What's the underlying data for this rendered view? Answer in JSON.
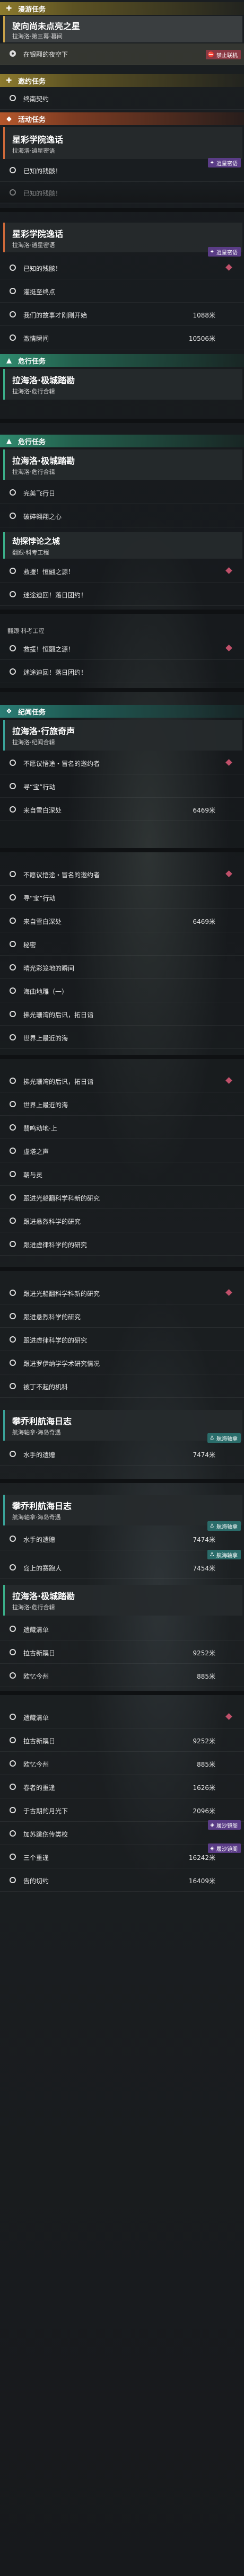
{
  "s1": {
    "header": "漫游任务",
    "title": "驶向尚未点亮之星",
    "sub": "拉海洛·第三幕·暮间",
    "row": "在银翮的夜空下",
    "tag": "禁止联机"
  },
  "s2": {
    "header": "邀约任务",
    "row": "终南契约"
  },
  "s3": {
    "header": "活动任务",
    "title": "星彩学院逸话",
    "sub": "拉海洛·逍星密语",
    "rows": [
      {
        "t": "已知的残骸！"
      },
      {
        "t": "已知的残骸！"
      }
    ],
    "tag": "逍星密语"
  },
  "s4": {
    "title": "星彩学院逸话",
    "sub": "拉海洛·逍星密语",
    "tag": "逍星密语",
    "rows": [
      {
        "t": "已知的残骸！"
      },
      {
        "t": "灌挺至终点"
      },
      {
        "t": "我们的故事才刚刚开始",
        "n": "1088米"
      },
      {
        "t": "激情瞬间",
        "n": "10506米"
      }
    ]
  },
  "s5": {
    "header": "危行任务",
    "title": "拉海洛·极城踏勘",
    "sub": "拉海洛·危行合辑"
  },
  "s6": {
    "header": "危行任务",
    "title": "拉海洛·极城踏勘",
    "sub": "拉海洛·危行合辑",
    "rows": [
      {
        "t": "完美飞行日"
      },
      {
        "t": "破碎翱翔之心"
      }
    ],
    "title2": "劫探悖论之城",
    "sub2": "翻跟·科考工程",
    "rows2": [
      {
        "t": "救援！恒翮之源！"
      },
      {
        "t": "迷途迫回！落日团约！"
      }
    ]
  },
  "s7": {
    "sub": "翻跟·科考工程",
    "rows": [
      {
        "t": "救援！恒翮之源！"
      },
      {
        "t": "迷途迫回！落日团约！"
      }
    ]
  },
  "s8": {
    "header": "纪闻任务",
    "title": "拉海洛·行旅奇声",
    "sub": "拉海洛·纪闻合辑",
    "rows": [
      {
        "t": "不愿议悟途・冒名的邀约者"
      },
      {
        "t": "寻“宝”行动"
      },
      {
        "t": "来自雪白深处",
        "n": "6469米"
      }
    ]
  },
  "s9": {
    "rows": [
      {
        "t": "不愿议悟途・冒名的邀约者"
      },
      {
        "t": "寻“宝”行动"
      },
      {
        "t": "来自雪白深处",
        "n": "6469米"
      },
      {
        "t": "秘密"
      },
      {
        "t": "晴光彩笼地的瞬间"
      },
      {
        "t": "海曲地雕（一）"
      },
      {
        "t": "拂光珊湾的后讯，拓日诣"
      },
      {
        "t": "世界上最近的海"
      }
    ]
  },
  "s10": {
    "rows": [
      {
        "t": "拂光珊湾的后讯，拓日诣"
      },
      {
        "t": "世界上最近的海"
      },
      {
        "t": "翡鸣动地·上"
      },
      {
        "t": "虚塔之声"
      },
      {
        "t": "朝与灵"
      },
      {
        "t": "跟进光船翻科学科新的研究"
      },
      {
        "t": "跟进悬烈科学的研究"
      },
      {
        "t": "跟进虚律科学的的研究"
      }
    ]
  },
  "s11": {
    "rows": [
      {
        "t": "跟进光船翻科学科新的研究"
      },
      {
        "t": "跟进悬烈科学的研究"
      },
      {
        "t": "跟进虚律科学的的研究"
      },
      {
        "t": "跟进罗伊纳学学术研究情况"
      },
      {
        "t": "被丁不起的机科"
      }
    ],
    "title": "攀乔利航海日志",
    "sub": "航海轴拿·海岛奇遇",
    "tag": "航海轴拿",
    "row2": {
      "t": "水手的遗赠",
      "n": "7474米"
    }
  },
  "s12": {
    "title": "攀乔利航海日志",
    "sub": "航海轴拿·海岛奇遇",
    "rows": [
      {
        "t": "水手的遗赠",
        "n": "7474米",
        "tag": "航海轴拿"
      },
      {
        "t": "岛上的赛跑人",
        "n": "7454米",
        "tag": "航海轴拿"
      }
    ],
    "title2": "拉海洛·极城踏勘",
    "sub2": "拉海洛·危行合辑",
    "rows2": [
      {
        "t": "遗藏清单"
      },
      {
        "t": "拉古新蹊日",
        "n": "9252米"
      },
      {
        "t": "欧忆今州",
        "n": "885米"
      }
    ]
  },
  "s13": {
    "rows": [
      {
        "t": "遗藏清单"
      },
      {
        "t": "拉古新蹊日",
        "n": "9252米"
      },
      {
        "t": "欧忆今州",
        "n": "885米"
      },
      {
        "t": "春者的重逢",
        "n": "1626米"
      },
      {
        "t": "于古期的月光下",
        "n": "2096米"
      },
      {
        "t": "加苏跳伤传类校",
        "tag": "履沙镜阁"
      },
      {
        "t": "三个重逢",
        "n": "16242米",
        "tag": "履沙镜阁"
      },
      {
        "t": "告的切约",
        "n": "16409米"
      }
    ]
  }
}
